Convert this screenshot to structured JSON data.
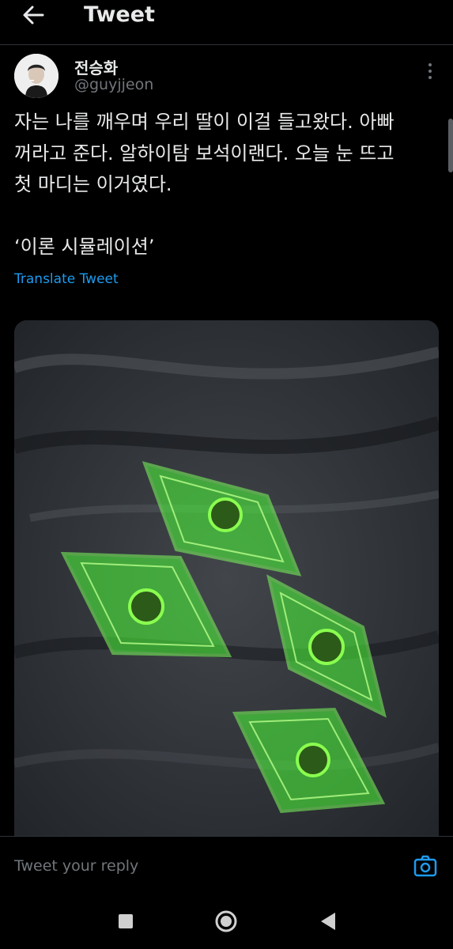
{
  "header": {
    "title": "Tweet",
    "back_icon": "arrow-left-icon"
  },
  "author": {
    "display_name": "전승화",
    "handle": "@guyjjeon"
  },
  "tweet": {
    "lines": [
      "자는 나를 깨우며 우리 딸이 이걸 들고왔다. 아빠",
      "꺼라고 준다. 알하이탐 보석이랜다. 오늘 눈 뜨고",
      "첫 마디는 이거였다."
    ],
    "quote": "‘이론 시뮬레이션’",
    "translate_label": "Translate Tweet"
  },
  "reply": {
    "placeholder": "Tweet your reply",
    "camera_icon": "camera-icon"
  },
  "system_nav": {
    "icons": [
      "square-icon",
      "circle-icon",
      "triangle-back-icon"
    ]
  },
  "colors": {
    "background": "#000000",
    "accent": "#1d9bf0",
    "text": "#e7e9ea",
    "muted": "#71767b",
    "gem_green": "#4cff3a"
  }
}
